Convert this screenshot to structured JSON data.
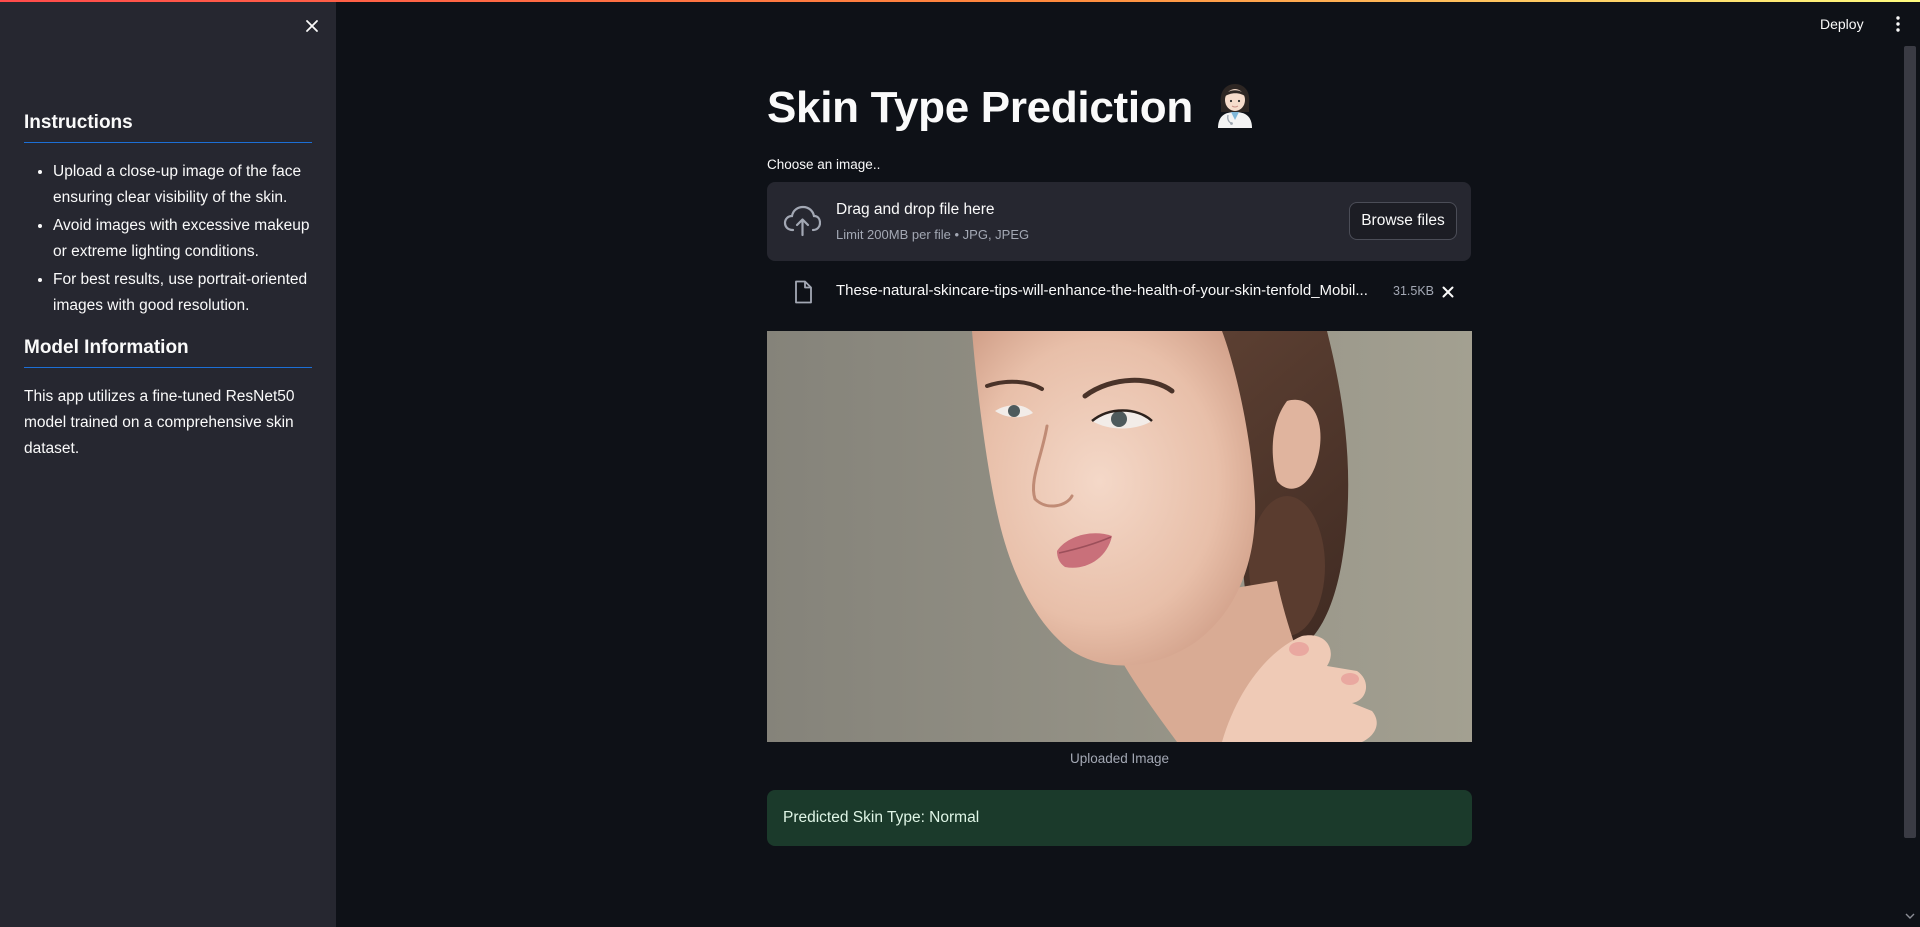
{
  "header": {
    "deploy_label": "Deploy",
    "menu_icon": "vertical-dots-icon"
  },
  "sidebar": {
    "close_icon": "close-icon",
    "instructions_heading": "Instructions",
    "instructions": [
      "Upload a close-up image of the face ensuring clear visibility of the skin.",
      "Avoid images with excessive makeup or extreme lighting conditions.",
      "For best results, use portrait-oriented images with good resolution."
    ],
    "model_heading": "Model Information",
    "model_text": "This app utilizes a fine-tuned ResNet50 model trained on a comprehensive skin dataset."
  },
  "main": {
    "title": "Skin Type Prediction",
    "title_emoji": "health-worker-emoji",
    "uploader_label": "Choose an image..",
    "dropzone": {
      "title": "Drag and drop file here",
      "subtitle": "Limit 200MB per file • JPG, JPEG",
      "browse_label": "Browse files",
      "icon": "cloud-upload-icon"
    },
    "file": {
      "name": "These-natural-skincare-tips-will-enhance-the-health-of-your-skin-tenfold_Mobil...",
      "size": "31.5KB",
      "icon": "file-icon",
      "remove_icon": "close-icon"
    },
    "image_caption": "Uploaded Image",
    "prediction": "Predicted Skin Type: Normal"
  },
  "colors": {
    "background": "#0e1117",
    "sidebar": "#262730",
    "accent_line": "#1c6fd6",
    "success_bg": "#1b3a2b"
  }
}
